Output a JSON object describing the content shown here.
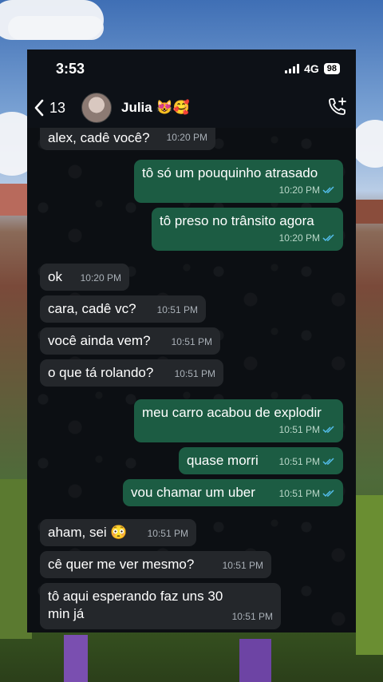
{
  "status_bar": {
    "time": "3:53",
    "network": "4G",
    "battery": "98"
  },
  "header": {
    "back_count": "13",
    "contact_name": "Julia 😻🥰"
  },
  "messages": [
    {
      "dir": "in",
      "text": "alex, cadê você?",
      "time": "10:20 PM"
    },
    {
      "dir": "out",
      "text": "tô só um pouquinho atrasado",
      "time": "10:20 PM"
    },
    {
      "dir": "out",
      "text": "tô preso no trânsito agora",
      "time": "10:20 PM"
    },
    {
      "dir": "in",
      "text": "ok",
      "time": "10:20 PM"
    },
    {
      "dir": "in",
      "text": "cara, cadê vc?",
      "time": "10:51 PM"
    },
    {
      "dir": "in",
      "text": "você ainda vem?",
      "time": "10:51 PM"
    },
    {
      "dir": "in",
      "text": "o que tá rolando?",
      "time": "10:51 PM"
    },
    {
      "dir": "out",
      "text": "meu carro acabou de explodir",
      "time": "10:51 PM"
    },
    {
      "dir": "out",
      "text": "quase morri",
      "time": "10:51 PM"
    },
    {
      "dir": "out",
      "text": "vou chamar um uber",
      "time": "10:51 PM"
    },
    {
      "dir": "in",
      "text": "aham, sei 😳",
      "time": "10:51 PM"
    },
    {
      "dir": "in",
      "text": "cê quer me ver mesmo?",
      "time": "10:51 PM"
    },
    {
      "dir": "in",
      "text": "tô aqui esperando faz uns 30 min já",
      "time": "10:51 PM"
    }
  ],
  "colors": {
    "incoming": "#24272b",
    "outgoing": "#1c5c43",
    "read_ticks": "#53bdeb"
  },
  "icons": {
    "back": "chevron-left-icon",
    "call_add": "phone-plus-icon",
    "read": "double-check-icon"
  }
}
